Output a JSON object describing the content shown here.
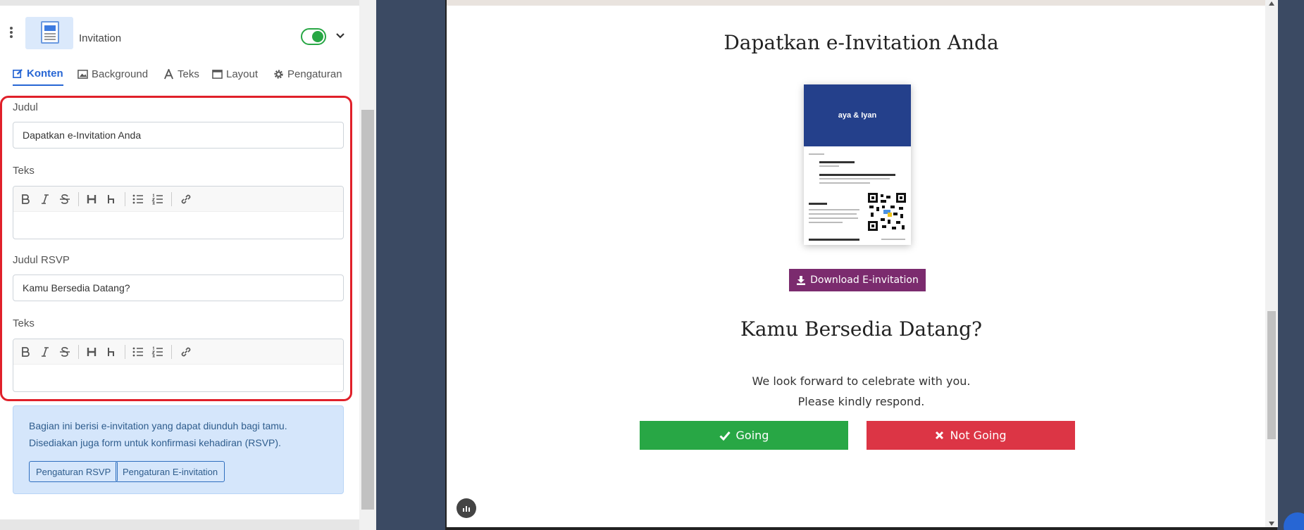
{
  "block": {
    "title": "Invitation",
    "enabled": true,
    "icon": "invitation-thumbnail"
  },
  "tabs": [
    {
      "label": "Konten",
      "icon": "edit-icon",
      "active": true
    },
    {
      "label": "Background",
      "icon": "image-icon",
      "active": false
    },
    {
      "label": "Teks",
      "icon": "font-icon",
      "active": false
    },
    {
      "label": "Layout",
      "icon": "window-icon",
      "active": false
    },
    {
      "label": "Pengaturan",
      "icon": "gear-icon",
      "active": false
    }
  ],
  "form": {
    "judul_label": "Judul",
    "judul_value": "Dapatkan e-Invitation Anda",
    "teks1_label": "Teks",
    "judul_rsvp_label": "Judul RSVP",
    "judul_rsvp_value": "Kamu Bersedia Datang?",
    "teks2_label": "Teks",
    "toolbar": [
      "bold-icon",
      "italic-icon",
      "strikethrough-icon",
      "heading-large-icon",
      "heading-small-icon",
      "bullet-list-icon",
      "numbered-list-icon",
      "link-icon"
    ]
  },
  "info": {
    "text": "Bagian ini berisi e-invitation yang dapat diunduh bagi tamu. Disediakan juga form untuk konfirmasi kehadiran (RSVP).",
    "rsvp_button": "Pengaturan RSVP",
    "einvite_button": "Pengaturan E-invitation"
  },
  "preview": {
    "heading": "Dapatkan e-Invitation Anda",
    "card_names": "aya & Iyan",
    "download_label": "Download E-invitation",
    "rsvp_heading": "Kamu Bersedia Datang?",
    "line1": "We look forward to celebrate with you.",
    "line2": "Please kindly respond.",
    "going_label": "Going",
    "not_going_label": "Not Going"
  },
  "colors": {
    "accent": "#2766d4",
    "highlight_border": "#e0202a",
    "download": "#7b2b6e",
    "going": "#28a745",
    "not_going": "#dc3545",
    "card_header": "#24408b"
  }
}
